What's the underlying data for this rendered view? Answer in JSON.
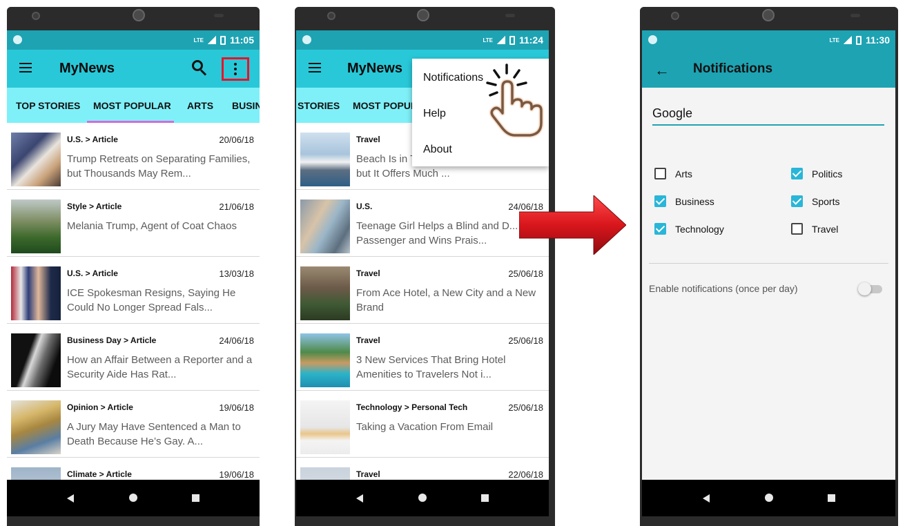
{
  "screen1": {
    "time": "11:05",
    "net": "LTE",
    "app_title": "MyNews",
    "tabs": [
      "TOP STORIES",
      "MOST POPULAR",
      "ARTS",
      "BUSIN"
    ],
    "articles": [
      {
        "section": "U.S. > Article",
        "date": "20/06/18",
        "title": "Trump Retreats on Separating Families, but Thousands May Rem..."
      },
      {
        "section": "Style > Article",
        "date": "21/06/18",
        "title": "Melania Trump, Agent of Coat Chaos"
      },
      {
        "section": "U.S. > Article",
        "date": "13/03/18",
        "title": "ICE Spokesman Resigns, Saying He Could No Longer Spread Fals..."
      },
      {
        "section": "Business Day > Article",
        "date": "24/06/18",
        "title": "How an Affair Between a Reporter and a Security Aide Has Rat..."
      },
      {
        "section": "Opinion > Article",
        "date": "19/06/18",
        "title": "A Jury May Have Sentenced a Man to Death Because He’s Gay. A..."
      },
      {
        "section": "Climate > Article",
        "date": "19/06/18",
        "title": ""
      }
    ]
  },
  "screen2": {
    "time": "11:24",
    "net": "LTE",
    "app_title": "MyNews",
    "tabs": [
      "STORIES",
      "MOST POPUL"
    ],
    "menu": [
      "Notifications",
      "Help",
      "About"
    ],
    "articles": [
      {
        "section": "Travel",
        "date": "",
        "title": "Beach Is in This California Town's Name, but It Offers Much ..."
      },
      {
        "section": "U.S.",
        "date": "24/06/18",
        "title": "Teenage Girl Helps a Blind and D... Passenger and Wins Prais..."
      },
      {
        "section": "Travel",
        "date": "25/06/18",
        "title": "From Ace Hotel, a New City and a New Brand"
      },
      {
        "section": "Travel",
        "date": "25/06/18",
        "title": "3 New Services That Bring Hotel Amenities to Travelers Not i..."
      },
      {
        "section": "Technology > Personal Tech",
        "date": "25/06/18",
        "title": "Taking a Vacation From Email"
      },
      {
        "section": "Travel",
        "date": "22/06/18",
        "title": ""
      }
    ]
  },
  "screen3": {
    "time": "11:30",
    "net": "LTE",
    "title": "Notifications",
    "query": "Google",
    "categories": [
      {
        "label": "Arts",
        "checked": false
      },
      {
        "label": "Politics",
        "checked": true
      },
      {
        "label": "Business",
        "checked": true
      },
      {
        "label": "Sports",
        "checked": true
      },
      {
        "label": "Technology",
        "checked": true
      },
      {
        "label": "Travel",
        "checked": false
      }
    ],
    "switch_label": "Enable notifications (once per day)",
    "switch_on": false
  },
  "colors": {
    "status_bar": "#1ea3b3",
    "app_bar": "#29c8d8",
    "tab_bar": "#7ff0f8",
    "tab_indicator": "#d46bd8",
    "highlight_box": "#e8132a",
    "arrow": "#d8161c",
    "checkbox": "#29b6d8"
  },
  "icons": [
    "hamburger-icon",
    "search-icon",
    "more-vert-icon",
    "back-arrow-icon",
    "tap-hand-icon",
    "nav-back-icon",
    "nav-home-icon",
    "nav-recents-icon"
  ]
}
